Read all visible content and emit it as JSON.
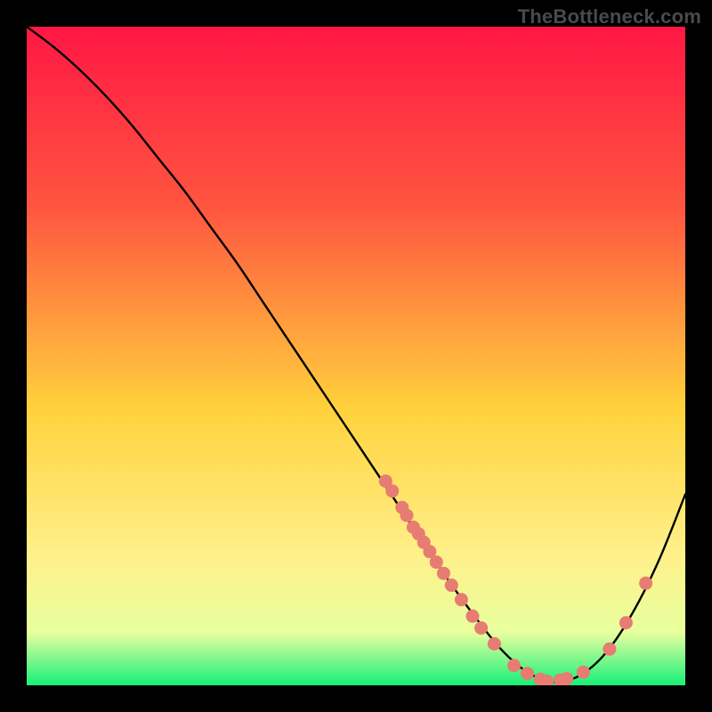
{
  "watermark": "TheBottleneck.com",
  "colors": {
    "background": "#000000",
    "strokeCurve": "#000000",
    "marker": "#e77c72",
    "gradTop": "#ff1744",
    "gradMidUpper": "#ff5740",
    "gradMid": "#ffd23c",
    "gradLowerA": "#fff08a",
    "gradLowerB": "#e8ff9e",
    "gradBottom": "#17f07a",
    "watermarkText": "#4a4a4a"
  },
  "chart_data": {
    "type": "line",
    "title": "",
    "xlabel": "",
    "ylabel": "",
    "xlim": [
      0,
      100
    ],
    "ylim": [
      0,
      100
    ],
    "series": [
      {
        "name": "bottleneck-curve",
        "x": [
          0,
          4,
          8,
          12,
          16,
          20,
          24,
          28,
          32,
          36,
          40,
          44,
          48,
          52,
          56,
          60,
          64,
          68,
          72,
          76,
          80,
          84,
          88,
          92,
          96,
          100
        ],
        "y": [
          100,
          97,
          93.5,
          89.5,
          85,
          80,
          75,
          69.5,
          64,
          58,
          52,
          46,
          40,
          34,
          28,
          22,
          16,
          10.5,
          5.5,
          2,
          0.5,
          1.5,
          5,
          11,
          19,
          29
        ]
      }
    ],
    "markers": [
      {
        "x": 54.5,
        "y": 31
      },
      {
        "x": 55.5,
        "y": 29.5
      },
      {
        "x": 57,
        "y": 27
      },
      {
        "x": 57.7,
        "y": 25.8
      },
      {
        "x": 58.7,
        "y": 24
      },
      {
        "x": 59.5,
        "y": 23
      },
      {
        "x": 60.3,
        "y": 21.7
      },
      {
        "x": 61.2,
        "y": 20.3
      },
      {
        "x": 62.2,
        "y": 18.7
      },
      {
        "x": 63.3,
        "y": 17
      },
      {
        "x": 64.5,
        "y": 15.2
      },
      {
        "x": 66,
        "y": 13
      },
      {
        "x": 67.7,
        "y": 10.5
      },
      {
        "x": 69,
        "y": 8.7
      },
      {
        "x": 71,
        "y": 6.3
      },
      {
        "x": 74,
        "y": 3
      },
      {
        "x": 76,
        "y": 1.8
      },
      {
        "x": 78,
        "y": 0.9
      },
      {
        "x": 79,
        "y": 0.6
      },
      {
        "x": 81,
        "y": 0.8
      },
      {
        "x": 82,
        "y": 1
      },
      {
        "x": 84.5,
        "y": 2
      },
      {
        "x": 88.5,
        "y": 5.5
      },
      {
        "x": 91,
        "y": 9.5
      },
      {
        "x": 94,
        "y": 15.5
      }
    ]
  }
}
